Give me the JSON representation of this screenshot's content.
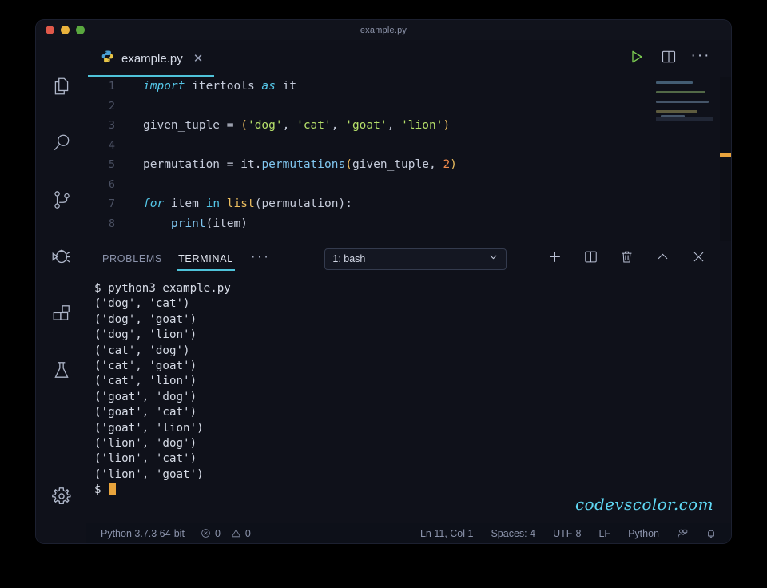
{
  "window": {
    "title": "example.py",
    "traffic_lights": [
      "close",
      "minimize",
      "zoom"
    ]
  },
  "activitybar": {
    "items": [
      {
        "name": "explorer",
        "icon": "files-icon",
        "active": true
      },
      {
        "name": "search",
        "icon": "search-icon",
        "active": false
      },
      {
        "name": "source-control",
        "icon": "source-control-icon",
        "active": false
      },
      {
        "name": "run-debug",
        "icon": "debug-icon",
        "active": false
      },
      {
        "name": "extensions",
        "icon": "extensions-icon",
        "active": false
      },
      {
        "name": "testing",
        "icon": "flask-icon",
        "active": false
      }
    ],
    "settings": {
      "name": "manage",
      "icon": "gear-icon"
    }
  },
  "tabbar": {
    "tab_label": "example.py",
    "tab_icon": "python-file-icon",
    "close_label": "✕",
    "run_title": "Run Python File",
    "split_title": "Split Editor",
    "more_label": "···"
  },
  "editor": {
    "lines": [
      {
        "n": "1",
        "tokens": [
          {
            "t": "import",
            "c": "kw"
          },
          {
            "t": " itertools ",
            "c": "plain"
          },
          {
            "t": "as",
            "c": "kw"
          },
          {
            "t": " it",
            "c": "plain"
          }
        ]
      },
      {
        "n": "2",
        "tokens": []
      },
      {
        "n": "3",
        "tokens": [
          {
            "t": "given_tuple ",
            "c": "plain"
          },
          {
            "t": "= ",
            "c": "punc"
          },
          {
            "t": "(",
            "c": "builtin"
          },
          {
            "t": "'dog'",
            "c": "str"
          },
          {
            "t": ", ",
            "c": "punc"
          },
          {
            "t": "'cat'",
            "c": "str"
          },
          {
            "t": ", ",
            "c": "punc"
          },
          {
            "t": "'goat'",
            "c": "str"
          },
          {
            "t": ", ",
            "c": "punc"
          },
          {
            "t": "'lion'",
            "c": "str"
          },
          {
            "t": ")",
            "c": "builtin"
          }
        ]
      },
      {
        "n": "4",
        "tokens": []
      },
      {
        "n": "5",
        "tokens": [
          {
            "t": "permutation ",
            "c": "plain"
          },
          {
            "t": "= ",
            "c": "punc"
          },
          {
            "t": "it",
            "c": "plain"
          },
          {
            "t": ".",
            "c": "punc"
          },
          {
            "t": "permutations",
            "c": "fn"
          },
          {
            "t": "(",
            "c": "builtin"
          },
          {
            "t": "given_tuple",
            "c": "plain"
          },
          {
            "t": ", ",
            "c": "punc"
          },
          {
            "t": "2",
            "c": "num"
          },
          {
            "t": ")",
            "c": "builtin"
          }
        ]
      },
      {
        "n": "6",
        "tokens": []
      },
      {
        "n": "7",
        "tokens": [
          {
            "t": "for",
            "c": "kw"
          },
          {
            "t": " item ",
            "c": "plain"
          },
          {
            "t": "in",
            "c": "kw2"
          },
          {
            "t": " ",
            "c": "plain"
          },
          {
            "t": "list",
            "c": "builtin"
          },
          {
            "t": "(",
            "c": "punc"
          },
          {
            "t": "permutation",
            "c": "plain"
          },
          {
            "t": "):",
            "c": "punc"
          }
        ]
      },
      {
        "n": "8",
        "tokens": [
          {
            "t": "    ",
            "c": "indent-guide"
          },
          {
            "t": "print",
            "c": "fn"
          },
          {
            "t": "(",
            "c": "punc"
          },
          {
            "t": "item",
            "c": "plain"
          },
          {
            "t": ")",
            "c": "punc"
          }
        ]
      }
    ],
    "minimap_present": true,
    "ruler_marker_color": "#e8a33d"
  },
  "panel": {
    "tabs": [
      {
        "label": "PROBLEMS",
        "active": false
      },
      {
        "label": "TERMINAL",
        "active": true
      }
    ],
    "more_label": "···",
    "terminal_selector": {
      "value": "1: bash",
      "chevron": "chevron-down-icon"
    },
    "actions": [
      {
        "name": "new-terminal",
        "icon": "plus-icon"
      },
      {
        "name": "split-terminal",
        "icon": "split-icon"
      },
      {
        "name": "kill-terminal",
        "icon": "trash-icon"
      },
      {
        "name": "maximize-panel",
        "icon": "chevron-up-icon"
      },
      {
        "name": "close-panel",
        "icon": "close-icon"
      }
    ]
  },
  "terminal": {
    "lines": [
      "$ python3 example.py",
      "('dog', 'cat')",
      "('dog', 'goat')",
      "('dog', 'lion')",
      "('cat', 'dog')",
      "('cat', 'goat')",
      "('cat', 'lion')",
      "('goat', 'dog')",
      "('goat', 'cat')",
      "('goat', 'lion')",
      "('lion', 'dog')",
      "('lion', 'cat')",
      "('lion', 'goat')"
    ],
    "prompt": "$ ",
    "cursor_color": "#e8a43c"
  },
  "watermark": {
    "text": "codevscolor.com",
    "color": "#5fd8f4"
  },
  "statusbar": {
    "python_version": "Python 3.7.3 64-bit",
    "errors": "0",
    "warnings": "0",
    "cursor_position": "Ln 11, Col 1",
    "indentation": "Spaces: 4",
    "encoding": "UTF-8",
    "eol": "LF",
    "language": "Python",
    "feedback_icon": "feedback-icon",
    "bell_icon": "bell-icon"
  }
}
